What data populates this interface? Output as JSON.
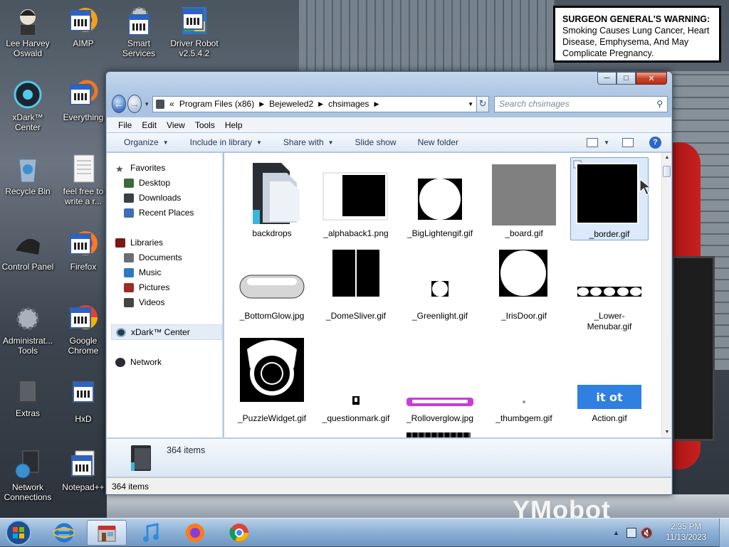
{
  "warning": {
    "bold": "SURGEON GENERAL'S WARNING:",
    "text": " Smoking Causes Lung Cancer, Heart Disease, Emphysema, And May Complicate Pregnancy."
  },
  "wallpaper_text": "YMobot",
  "desktop_icons": [
    {
      "label": "Lee Harvey Oswald",
      "icon": "person-icon"
    },
    {
      "label": "AIMP",
      "icon": "app-icon"
    },
    {
      "label": "Smart Services",
      "icon": "app-icon"
    },
    {
      "label": "Driver Robot v2.5.4.2",
      "icon": "app-icon"
    },
    {
      "label": "xDark™ Center",
      "icon": "xdark-icon"
    },
    {
      "label": "Everything",
      "icon": "app-icon"
    },
    {
      "label": "Recycle Bin",
      "icon": "recycle-bin-icon"
    },
    {
      "label": "feel free to write a r...",
      "icon": "text-file-icon"
    },
    {
      "label": "Control Panel",
      "icon": "control-panel-icon"
    },
    {
      "label": "Firefox",
      "icon": "app-icon"
    },
    {
      "label": "Administrat... Tools",
      "icon": "admin-tools-icon"
    },
    {
      "label": "Google Chrome",
      "icon": "app-icon"
    },
    {
      "label": "Extras",
      "icon": "folder-icon"
    },
    {
      "label": "HxD",
      "icon": "app-icon"
    },
    {
      "label": "Network Connections",
      "icon": "network-connections-icon"
    },
    {
      "label": "Notepad++",
      "icon": "app-icon"
    }
  ],
  "window": {
    "address": {
      "prefix": "«",
      "crumbs": [
        "Program Files (x86)",
        "Bejeweled2",
        "chsimages"
      ]
    },
    "search_placeholder": "Search chsimages",
    "menu": [
      "File",
      "Edit",
      "View",
      "Tools",
      "Help"
    ],
    "toolbar": {
      "organize": "Organize",
      "include": "Include in library",
      "share": "Share with",
      "slideshow": "Slide show",
      "newfolder": "New folder"
    },
    "nav": {
      "favorites": "Favorites",
      "favorites_items": [
        "Desktop",
        "Downloads",
        "Recent Places"
      ],
      "libraries": "Libraries",
      "library_items": [
        "Documents",
        "Music",
        "Pictures",
        "Videos"
      ],
      "xdark": "xDark™ Center",
      "network": "Network"
    },
    "files": [
      {
        "name": "backdrops",
        "kind": "folder"
      },
      {
        "name": "_alphaback1.png",
        "kind": "square-black"
      },
      {
        "name": "_BigLightengif.gif",
        "kind": "circle"
      },
      {
        "name": "_board.gif",
        "kind": "gray"
      },
      {
        "name": "_border.gif",
        "kind": "border"
      },
      {
        "name": "_BottomGlow.jpg",
        "kind": "glow-bar"
      },
      {
        "name": "_DomeSliver.gif",
        "kind": "dome"
      },
      {
        "name": "_Greenlight.gif",
        "kind": "small-circle"
      },
      {
        "name": "_IrisDoor.gif",
        "kind": "circle-big"
      },
      {
        "name": "_Lower-Menubar.gif",
        "kind": "menubar-strip"
      },
      {
        "name": "_PuzzleWidget.gif",
        "kind": "ring"
      },
      {
        "name": "_questionmark.gif",
        "kind": "tiny"
      },
      {
        "name": "_Rolloverglow.jpg",
        "kind": "purple-glow"
      },
      {
        "name": "_thumbgem.gif",
        "kind": "dot"
      },
      {
        "name": "Action.gif",
        "kind": "action"
      }
    ],
    "details_count": "364 items",
    "status_count": "364 items"
  },
  "taskbar": {
    "items": [
      "start-orb",
      "internet-explorer",
      "explorer",
      "music",
      "firefox",
      "chrome"
    ],
    "time": "2:35 PM",
    "date": "11/13/2023"
  }
}
